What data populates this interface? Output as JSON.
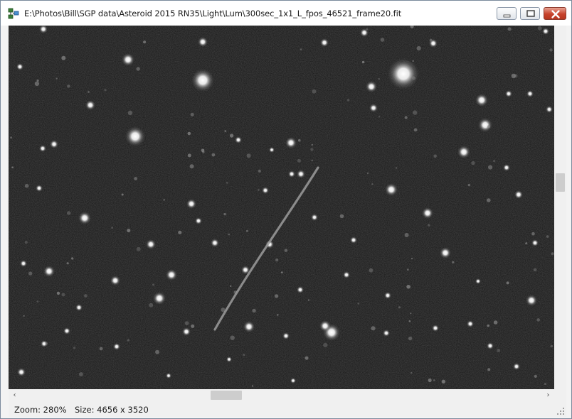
{
  "window": {
    "title": "E:\\Photos\\Bill\\SGP data\\Asteroid 2015 RN35\\Light\\Lum\\300sec_1x1_L_fpos_46521_frame20.fit",
    "app_icon": "image-viewer-icon",
    "controls": {
      "minimize_icon": "minimize-icon",
      "maximize_icon": "maximize-icon",
      "close_icon": "close-icon"
    }
  },
  "image": {
    "subject": "star field with asteroid streak",
    "background_color": "#202020"
  },
  "scrollbars": {
    "left_arrow": "‹",
    "right_arrow": "›"
  },
  "status": {
    "zoom": "Zoom: 280%",
    "size": "Size: 4656 x 3520"
  },
  "colors": {
    "close_button": "#c8432c",
    "window_border": "#7a8a9c"
  }
}
